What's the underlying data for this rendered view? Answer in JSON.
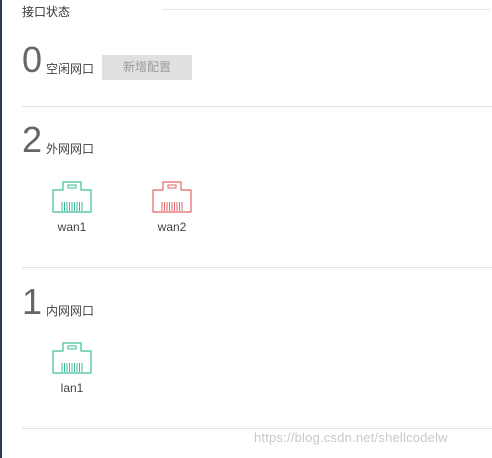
{
  "header": {
    "title": "接口状态"
  },
  "idle": {
    "count": "0",
    "label": "空闲网口",
    "add_button": "新增配置"
  },
  "wan": {
    "count": "2",
    "label": "外网网口",
    "ports": [
      {
        "name": "wan1",
        "status": "connected",
        "color": "#3ebc9a"
      },
      {
        "name": "wan2",
        "status": "disconnected",
        "color": "#e0676b"
      }
    ]
  },
  "lan": {
    "count": "1",
    "label": "内网网口",
    "ports": [
      {
        "name": "lan1",
        "status": "connected",
        "color": "#3ebc9a"
      }
    ]
  },
  "watermark": "https://blog.csdn.net/shellcodelw",
  "icons": {
    "port": "ethernet-port-icon"
  }
}
